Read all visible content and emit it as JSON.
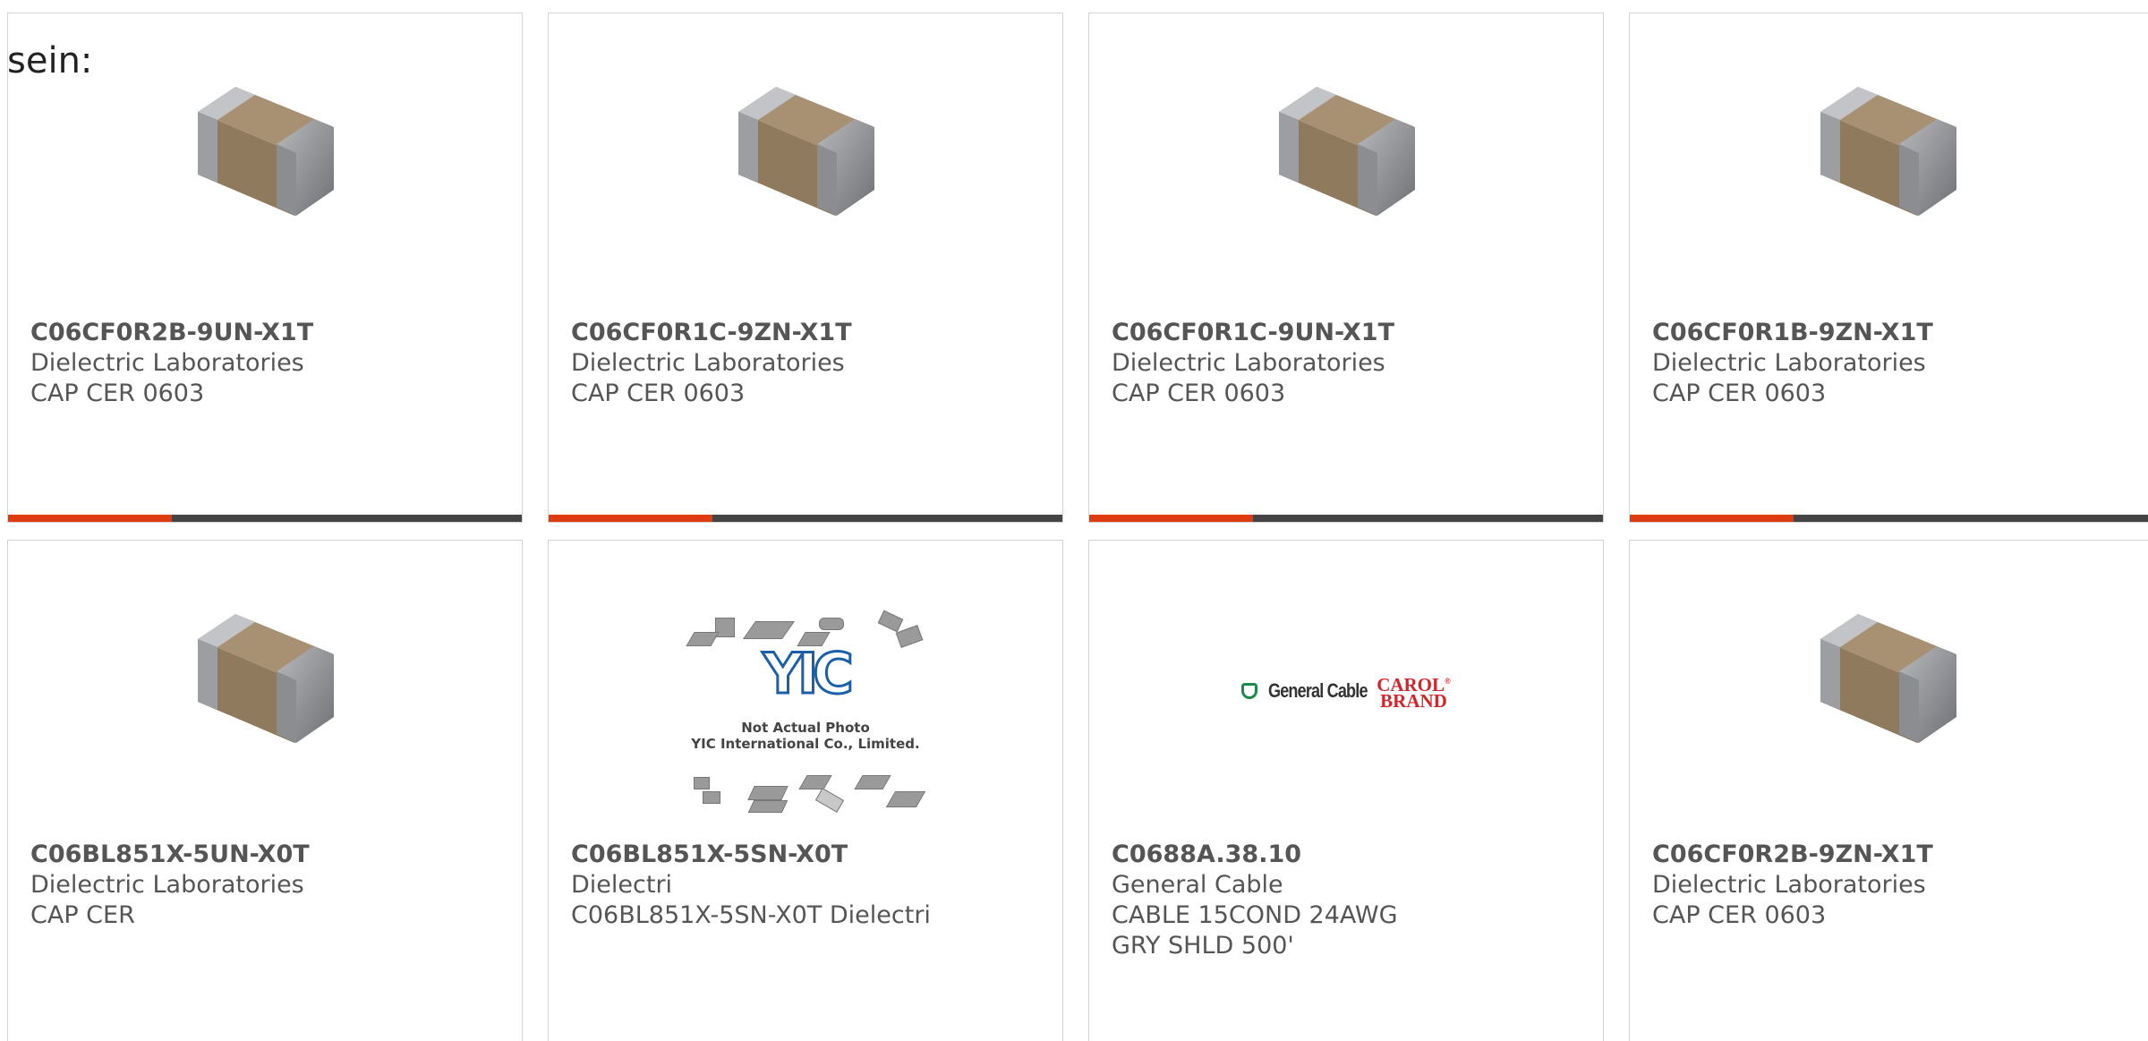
{
  "lead_text": "sein:",
  "colors": {
    "accent": "#e03c12",
    "bar": "#444444",
    "card_border": "#d4d4d4",
    "text": "#555555",
    "capacitor_body": "#8f7a5e",
    "capacitor_terminal": "#8b8d90"
  },
  "products": [
    {
      "part_number": "C06CF0R2B-9UN-X1T",
      "manufacturer": "Dielectric Laboratories",
      "description": "CAP CER 0603",
      "image": "capacitor-image"
    },
    {
      "part_number": "C06CF0R1C-9ZN-X1T",
      "manufacturer": "Dielectric Laboratories",
      "description": "CAP CER 0603",
      "image": "capacitor-image"
    },
    {
      "part_number": "C06CF0R1C-9UN-X1T",
      "manufacturer": "Dielectric Laboratories",
      "description": "CAP CER 0603",
      "image": "capacitor-image"
    },
    {
      "part_number": "C06CF0R1B-9ZN-X1T",
      "manufacturer": "Dielectric Laboratories",
      "description": "CAP CER 0603",
      "image": "capacitor-image"
    },
    {
      "part_number": "C06BL851X-5UN-X0T",
      "manufacturer": "Dielectric Laboratories",
      "description": "CAP CER",
      "image": "capacitor-image"
    },
    {
      "part_number": "C06BL851X-5SN-X0T",
      "manufacturer": "Dielectri",
      "description": "C06BL851X-5SN-X0T Dielectri",
      "image": "yic-placeholder-image",
      "image_text": {
        "logo": "YIC",
        "line1": "Not Actual Photo",
        "line2": "YIC International Co., Limited."
      }
    },
    {
      "part_number": "C0688A.38.10",
      "manufacturer": "General Cable",
      "description": "CABLE 15COND 24AWG GRY SHLD 500'",
      "image": "general-cable-logo",
      "image_text": {
        "brand1": "General Cable",
        "brand2_line1": "CAROL",
        "brand2_sup": "®",
        "brand2_line2": "BRAND"
      }
    },
    {
      "part_number": "C06CF0R2B-9ZN-X1T",
      "manufacturer": "Dielectric Laboratories",
      "description": "CAP CER 0603",
      "image": "capacitor-image"
    }
  ]
}
